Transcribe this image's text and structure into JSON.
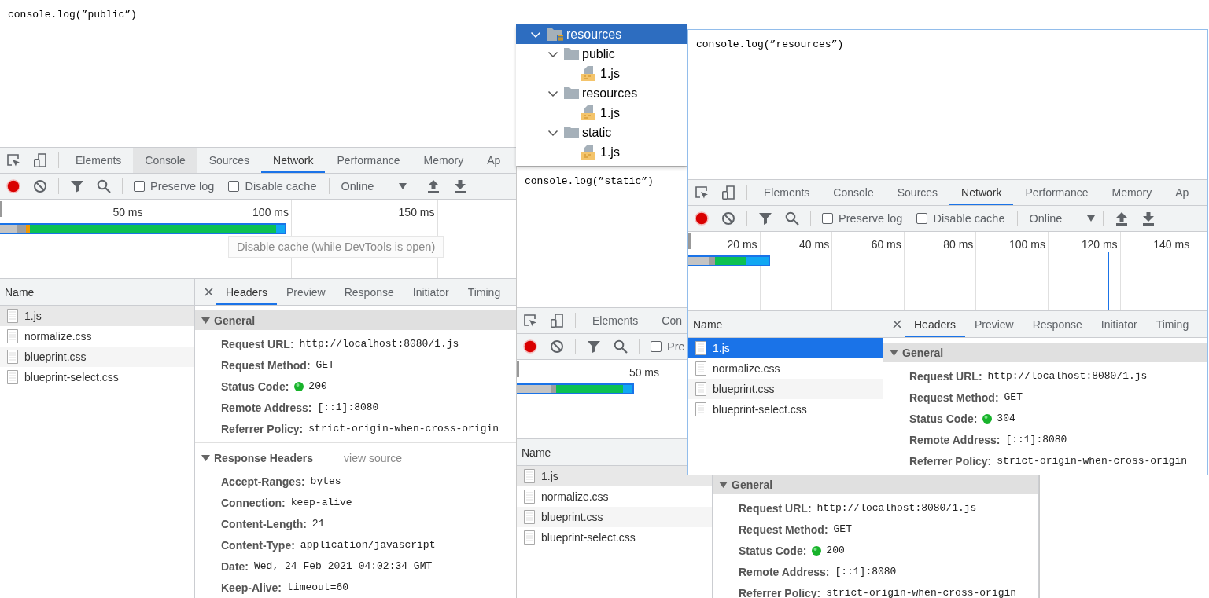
{
  "windows": [
    {
      "active": false,
      "page_text": "console.log(”public”)",
      "devtools": {
        "tabs": [
          {
            "label": "Elements",
            "selected": false,
            "hovered": false
          },
          {
            "label": "Console",
            "selected": false,
            "hovered": true
          },
          {
            "label": "Sources",
            "selected": false,
            "hovered": false
          },
          {
            "label": "Network",
            "selected": true,
            "hovered": false
          },
          {
            "label": "Performance",
            "selected": false,
            "hovered": false
          },
          {
            "label": "Memory",
            "selected": false,
            "hovered": false
          },
          {
            "label": "Ap",
            "selected": false,
            "hovered": false
          }
        ],
        "toolbar": [
          {
            "kind": "checkbox",
            "label": "Preserve log",
            "checked": false
          },
          {
            "kind": "checkbox",
            "label": "Disable cache",
            "checked": false
          },
          {
            "kind": "select",
            "label": "Online"
          },
          {
            "kind": "import_export"
          }
        ],
        "tooltip": "Disable cache (while DevTools is open)",
        "timeline": {
          "ticks": [
            "50 ms",
            "100 ms",
            "150 ms"
          ]
        },
        "requests": {
          "header": "Name",
          "rows": [
            {
              "name": "1.js",
              "selected": true
            },
            {
              "name": "normalize.css",
              "selected": false
            },
            {
              "name": "blueprint.css",
              "selected": false
            },
            {
              "name": "blueprint-select.css",
              "selected": false
            }
          ]
        },
        "details": {
          "tabs": [
            {
              "label": "Headers",
              "selected": true
            },
            {
              "label": "Preview",
              "selected": false
            },
            {
              "label": "Response",
              "selected": false
            },
            {
              "label": "Initiator",
              "selected": false
            },
            {
              "label": "Timing",
              "selected": false
            }
          ],
          "sections": [
            {
              "title": "General",
              "expanded": true,
              "focused": true,
              "rows": [
                {
                  "kind": "text",
                  "key": "Request URL:",
                  "value": "http://localhost:8080/1.js"
                },
                {
                  "kind": "text",
                  "key": "Request Method:",
                  "value": "GET"
                },
                {
                  "kind": "status",
                  "key": "Status Code:",
                  "value": "200"
                },
                {
                  "kind": "text",
                  "key": "Remote Address:",
                  "value": "[::1]:8080"
                },
                {
                  "kind": "text",
                  "key": "Referrer Policy:",
                  "value": "strict-origin-when-cross-origin"
                }
              ]
            },
            {
              "title": "Response Headers",
              "expanded": true,
              "focused": false,
              "link": "view source",
              "rows": [
                {
                  "kind": "text",
                  "key": "Accept-Ranges:",
                  "value": "bytes"
                },
                {
                  "kind": "text",
                  "key": "Connection:",
                  "value": "keep-alive"
                },
                {
                  "kind": "text",
                  "key": "Content-Length:",
                  "value": "21"
                },
                {
                  "kind": "text",
                  "key": "Content-Type:",
                  "value": "application/javascript"
                },
                {
                  "kind": "text",
                  "key": "Date:",
                  "value": "Wed, 24 Feb 2021 04:02:34 GMT"
                },
                {
                  "kind": "text",
                  "key": "Keep-Alive:",
                  "value": "timeout=60"
                }
              ]
            }
          ]
        }
      }
    },
    {
      "active": false,
      "page_text": "console.log(”static”)",
      "devtools": {
        "tabs": [
          {
            "label": "Elements",
            "selected": false,
            "hovered": false
          },
          {
            "label": "Con",
            "selected": false,
            "hovered": false
          }
        ],
        "toolbar": [
          {
            "kind": "checkbox",
            "label": "Pre",
            "checked": false
          }
        ],
        "timeline": {
          "ticks": [
            "50 ms"
          ]
        },
        "requests": {
          "header": "Name",
          "rows": [
            {
              "name": "1.js",
              "selected": true
            },
            {
              "name": "normalize.css",
              "selected": false
            },
            {
              "name": "blueprint.css",
              "selected": false
            },
            {
              "name": "blueprint-select.css",
              "selected": false
            }
          ]
        },
        "details": {
          "sections": [
            {
              "title": "General",
              "expanded": true,
              "focused": true,
              "rows": [
                {
                  "kind": "text",
                  "key": "Request URL:",
                  "value": "http://localhost:8080/1.js"
                },
                {
                  "kind": "text",
                  "key": "Request Method:",
                  "value": "GET"
                },
                {
                  "kind": "status",
                  "key": "Status Code:",
                  "value": "200"
                },
                {
                  "kind": "text",
                  "key": "Remote Address:",
                  "value": "[::1]:8080"
                },
                {
                  "kind": "text",
                  "key": "Referrer Policy:",
                  "value": "strict-origin-when-cross-origin"
                }
              ]
            }
          ]
        }
      }
    },
    {
      "active": true,
      "page_text": "console.log(”resources”)",
      "devtools": {
        "tabs": [
          {
            "label": "Elements",
            "selected": false,
            "hovered": false
          },
          {
            "label": "Console",
            "selected": false,
            "hovered": false
          },
          {
            "label": "Sources",
            "selected": false,
            "hovered": false
          },
          {
            "label": "Network",
            "selected": true,
            "hovered": false
          },
          {
            "label": "Performance",
            "selected": false,
            "hovered": false
          },
          {
            "label": "Memory",
            "selected": false,
            "hovered": false
          },
          {
            "label": "Ap",
            "selected": false,
            "hovered": false
          }
        ],
        "toolbar": [
          {
            "kind": "checkbox",
            "label": "Preserve log",
            "checked": false
          },
          {
            "kind": "checkbox",
            "label": "Disable cache",
            "checked": false
          },
          {
            "kind": "select",
            "label": "Online"
          },
          {
            "kind": "import_export"
          }
        ],
        "timeline": {
          "ticks": [
            "20 ms",
            "40 ms",
            "60 ms",
            "80 ms",
            "100 ms",
            "120 ms",
            "140 ms"
          ]
        },
        "requests": {
          "header": "Name",
          "rows": [
            {
              "name": "1.js",
              "selected": true
            },
            {
              "name": "normalize.css",
              "selected": false
            },
            {
              "name": "blueprint.css",
              "selected": false
            },
            {
              "name": "blueprint-select.css",
              "selected": false
            }
          ]
        },
        "details": {
          "tabs": [
            {
              "label": "Headers",
              "selected": true
            },
            {
              "label": "Preview",
              "selected": false
            },
            {
              "label": "Response",
              "selected": false
            },
            {
              "label": "Initiator",
              "selected": false
            },
            {
              "label": "Timing",
              "selected": false
            }
          ],
          "sections": [
            {
              "title": "General",
              "expanded": true,
              "focused": true,
              "rows": [
                {
                  "kind": "text",
                  "key": "Request URL:",
                  "value": "http://localhost:8080/1.js"
                },
                {
                  "kind": "text",
                  "key": "Request Method:",
                  "value": "GET"
                },
                {
                  "kind": "status",
                  "key": "Status Code:",
                  "value": "304"
                },
                {
                  "kind": "text",
                  "key": "Remote Address:",
                  "value": "[::1]:8080"
                },
                {
                  "kind": "text",
                  "key": "Referrer Policy:",
                  "value": "strict-origin-when-cross-origin"
                }
              ]
            }
          ]
        }
      }
    }
  ],
  "file_tree": {
    "items": [
      {
        "kind": "root_folder",
        "label": "resources",
        "expanded": true,
        "selected": true,
        "children": [
          {
            "kind": "folder",
            "label": "public",
            "expanded": true,
            "selected": false,
            "children": [
              {
                "kind": "file",
                "label": "1.js",
                "selected": false
              }
            ]
          },
          {
            "kind": "folder",
            "label": "resources",
            "expanded": true,
            "selected": false,
            "children": [
              {
                "kind": "file",
                "label": "1.js",
                "selected": false
              }
            ]
          },
          {
            "kind": "folder",
            "label": "static",
            "expanded": true,
            "selected": false,
            "children": [
              {
                "kind": "file",
                "label": "1.js",
                "selected": false
              }
            ]
          }
        ]
      }
    ]
  }
}
